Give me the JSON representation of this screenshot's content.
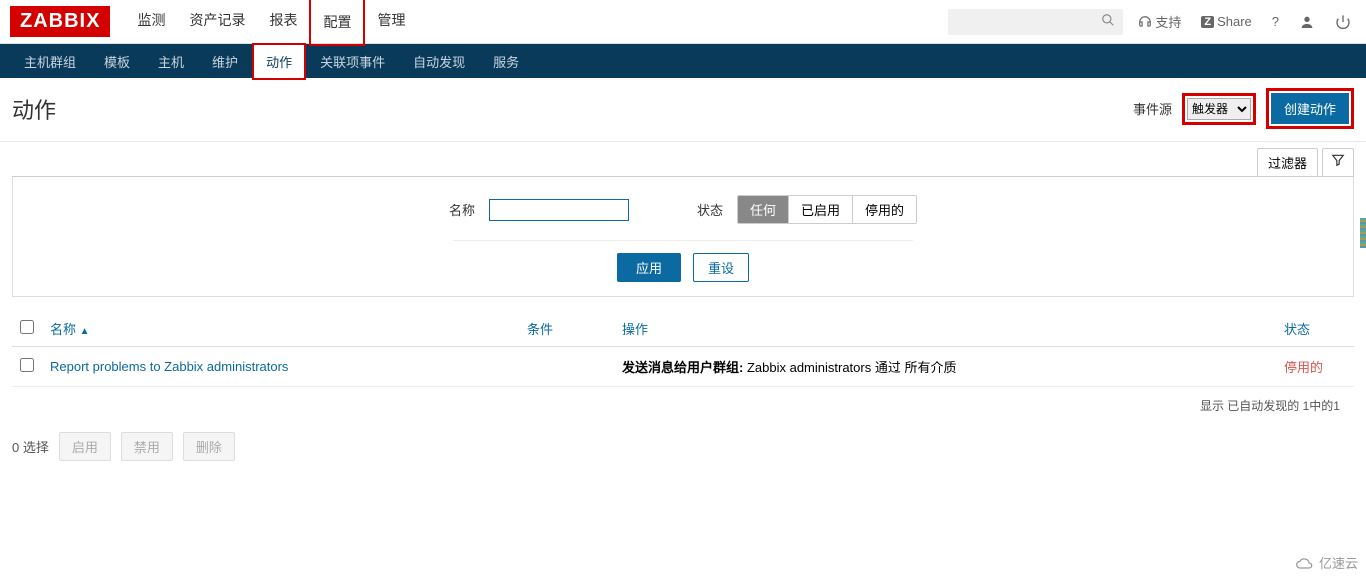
{
  "logo": "ZABBIX",
  "topnav": {
    "items": [
      "监测",
      "资产记录",
      "报表",
      "配置",
      "管理"
    ],
    "active_index": 3
  },
  "topright": {
    "support": "支持",
    "share": "Share",
    "help": "?"
  },
  "subnav": {
    "items": [
      "主机群组",
      "模板",
      "主机",
      "维护",
      "动作",
      "关联项事件",
      "自动发现",
      "服务"
    ],
    "active_index": 4
  },
  "page": {
    "title": "动作",
    "event_source_label": "事件源",
    "event_source_value": "触发器",
    "create_button": "创建动作"
  },
  "filter": {
    "tab_label": "过滤器",
    "name_label": "名称",
    "name_value": "",
    "status_label": "状态",
    "status_options": [
      "任何",
      "已启用",
      "停用的"
    ],
    "status_active_index": 0,
    "apply": "应用",
    "reset": "重设"
  },
  "table": {
    "headers": {
      "name": "名称",
      "conditions": "条件",
      "operations": "操作",
      "status": "状态"
    },
    "rows": [
      {
        "name": "Report problems to Zabbix administrators",
        "conditions": "",
        "operations_bold": "发送消息给用户群组:",
        "operations_rest": " Zabbix administrators 通过 所有介质",
        "status": "停用的"
      }
    ],
    "footer": "显示 已自动发现的 1中的1"
  },
  "bottom": {
    "selected": "0 选择",
    "enable": "启用",
    "disable": "禁用",
    "delete": "删除"
  },
  "watermark": "亿速云"
}
